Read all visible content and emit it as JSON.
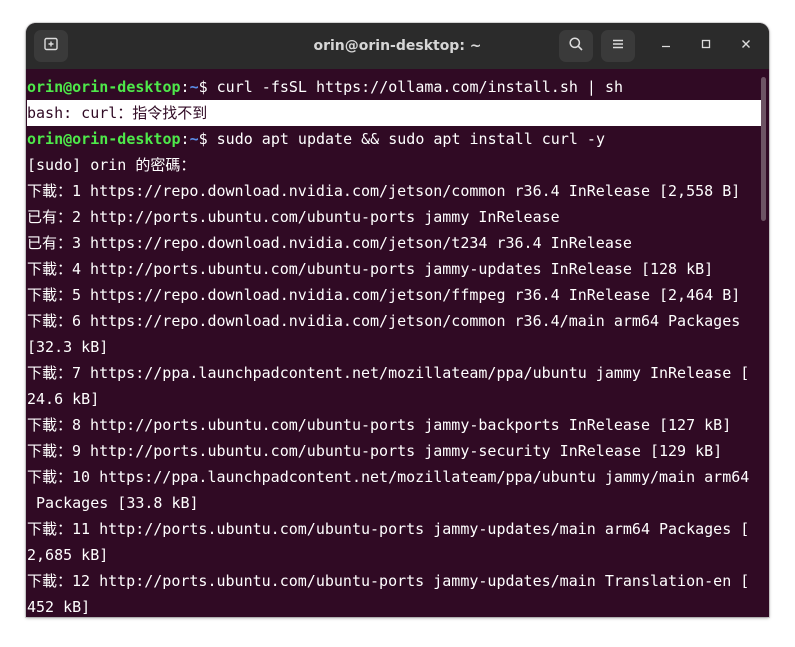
{
  "window": {
    "title": "orin@orin-desktop: ~"
  },
  "titlebar_icons": {
    "new_tab": "new-tab-icon",
    "search": "search-icon",
    "menu": "hamburger-menu-icon",
    "minimize": "minimize-icon",
    "maximize": "maximize-icon",
    "close": "close-icon"
  },
  "terminal": {
    "prompt": {
      "user_host": "orin@orin-desktop",
      "sep": ":",
      "path": "~",
      "symbol": "$ "
    },
    "commands": [
      "curl -fsSL https://ollama.com/install.sh | sh",
      "sudo apt update && sudo apt install curl -y"
    ],
    "output": [
      "bash: curl：指令找不到",
      "[sudo] orin 的密碼：",
      "下載：1 https://repo.download.nvidia.com/jetson/common r36.4 InRelease [2,558 B]",
      "已有：2 http://ports.ubuntu.com/ubuntu-ports jammy InRelease",
      "已有：3 https://repo.download.nvidia.com/jetson/t234 r36.4 InRelease",
      "下載：4 http://ports.ubuntu.com/ubuntu-ports jammy-updates InRelease [128 kB]",
      "下載：5 https://repo.download.nvidia.com/jetson/ffmpeg r36.4 InRelease [2,464 B]",
      "下載：6 https://repo.download.nvidia.com/jetson/common r36.4/main arm64 Packages",
      "[32.3 kB]",
      "下載：7 https://ppa.launchpadcontent.net/mozillateam/ppa/ubuntu jammy InRelease [",
      "24.6 kB]",
      "下載：8 http://ports.ubuntu.com/ubuntu-ports jammy-backports InRelease [127 kB]",
      "下載：9 http://ports.ubuntu.com/ubuntu-ports jammy-security InRelease [129 kB]",
      "下載：10 https://ppa.launchpadcontent.net/mozillateam/ppa/ubuntu jammy/main arm64",
      " Packages [33.8 kB]",
      "下載：11 http://ports.ubuntu.com/ubuntu-ports jammy-updates/main arm64 Packages [",
      "2,685 kB]",
      "下載：12 http://ports.ubuntu.com/ubuntu-ports jammy-updates/main Translation-en [",
      "452 kB]"
    ]
  },
  "colors": {
    "terminal_bg": "#300a24",
    "titlebar_bg": "#2b2b2b",
    "prompt_user": "#4ee94a",
    "prompt_path": "#5b8de8",
    "text": "#ffffff"
  }
}
